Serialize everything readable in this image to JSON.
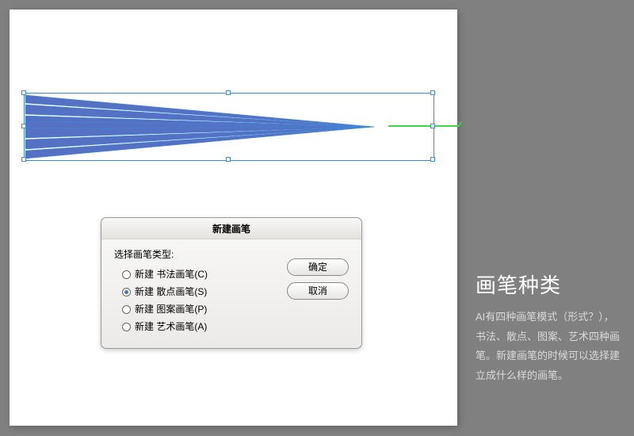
{
  "dialog": {
    "title": "新建画笔",
    "type_label": "选择画笔类型:",
    "options": [
      {
        "label": "新建 书法画笔(C)",
        "checked": false
      },
      {
        "label": "新建 散点画笔(S)",
        "checked": true
      },
      {
        "label": "新建 图案画笔(P)",
        "checked": false
      },
      {
        "label": "新建 艺术画笔(A)",
        "checked": false
      }
    ],
    "ok": "确定",
    "cancel": "取消"
  },
  "sidebar": {
    "heading": "画笔种类",
    "body": "AI有四种画笔模式（形式？），书法、散点、图案、艺术四种画笔。新建画笔的时候可以选择建立成什么样的画笔。"
  }
}
